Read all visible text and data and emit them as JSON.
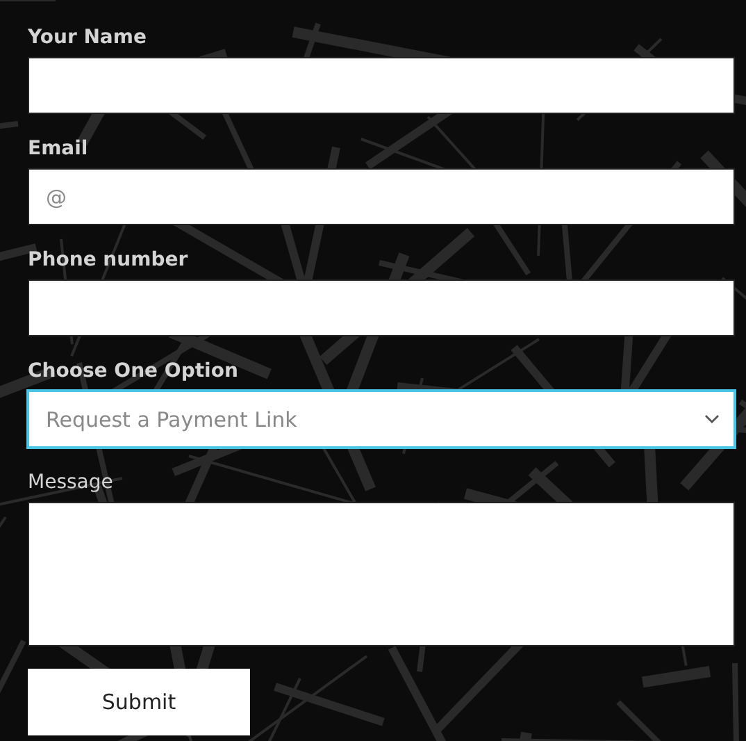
{
  "fields": [
    {
      "kind": "text",
      "label": "Your Name"
    },
    {
      "kind": "text",
      "label": "Email",
      "placeholder": "@"
    },
    {
      "kind": "text",
      "label": "Phone number"
    },
    {
      "kind": "select",
      "label": "Choose One Option",
      "value": "Request a Payment Link",
      "focused": true
    },
    {
      "kind": "textarea",
      "label": "Message"
    }
  ],
  "submit": "Submit"
}
